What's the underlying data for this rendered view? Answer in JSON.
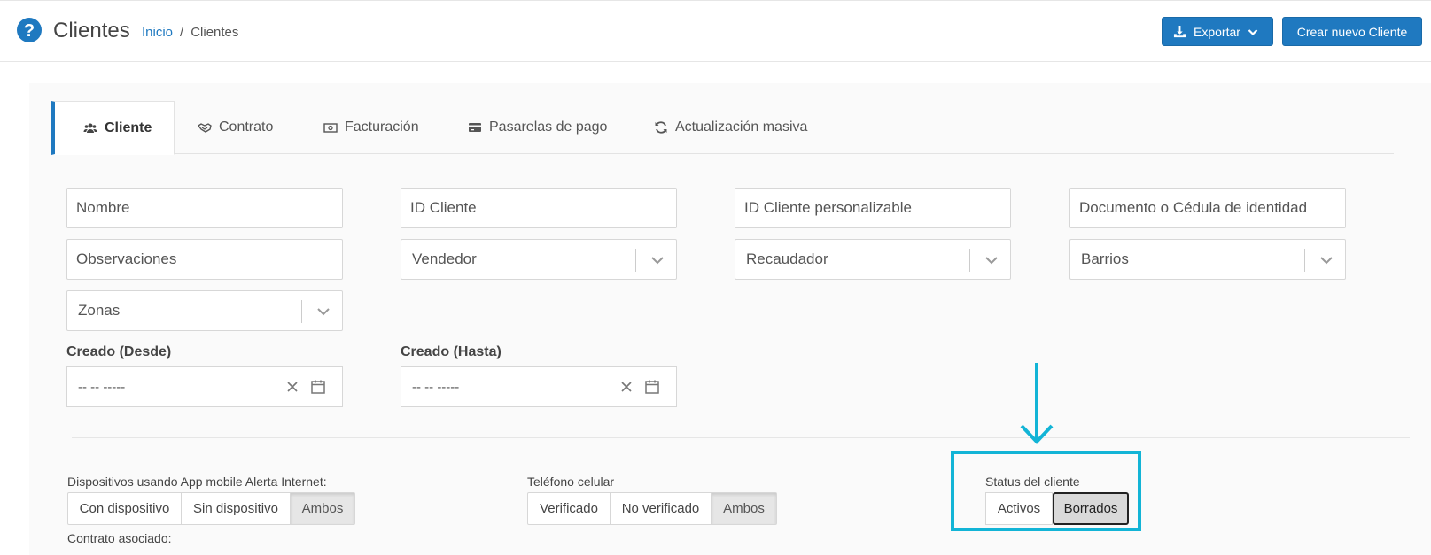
{
  "header": {
    "title": "Clientes",
    "breadcrumb": {
      "home": "Inicio",
      "separator": "/",
      "current": "Clientes"
    },
    "export_label": "Exportar",
    "create_label": "Crear nuevo Cliente"
  },
  "tabs": [
    {
      "label": "Cliente",
      "icon": "users-icon",
      "active": true
    },
    {
      "label": "Contrato",
      "icon": "handshake-icon",
      "active": false
    },
    {
      "label": "Facturación",
      "icon": "money-icon",
      "active": false
    },
    {
      "label": "Pasarelas de pago",
      "icon": "credit-card-icon",
      "active": false
    },
    {
      "label": "Actualización masiva",
      "icon": "refresh-icon",
      "active": false
    }
  ],
  "filters": {
    "nombre": "Nombre",
    "id_cliente": "ID Cliente",
    "id_personalizable": "ID Cliente personalizable",
    "documento": "Documento o Cédula de identidad",
    "observaciones": "Observaciones",
    "vendedor": "Vendedor",
    "recaudador": "Recaudador",
    "barrios": "Barrios",
    "zonas": "Zonas",
    "creado_desde": {
      "label": "Creado (Desde)",
      "value": "-- -- -----"
    },
    "creado_hasta": {
      "label": "Creado (Hasta)",
      "value": "-- -- -----"
    }
  },
  "groups": {
    "dispositivos": {
      "label": "Dispositivos usando App mobile Alerta Internet:",
      "options": [
        "Con dispositivo",
        "Sin dispositivo",
        "Ambos"
      ],
      "selected": "Ambos"
    },
    "telefono": {
      "label": "Teléfono celular",
      "options": [
        "Verificado",
        "No verificado",
        "Ambos"
      ],
      "selected": "Ambos"
    },
    "status": {
      "label": "Status del cliente",
      "options": [
        "Activos",
        "Borrados"
      ],
      "selected": "Borrados"
    }
  },
  "footer_label": "Contrato asociado:",
  "colors": {
    "primary": "#1f79c0",
    "highlight": "#12b4d6"
  }
}
